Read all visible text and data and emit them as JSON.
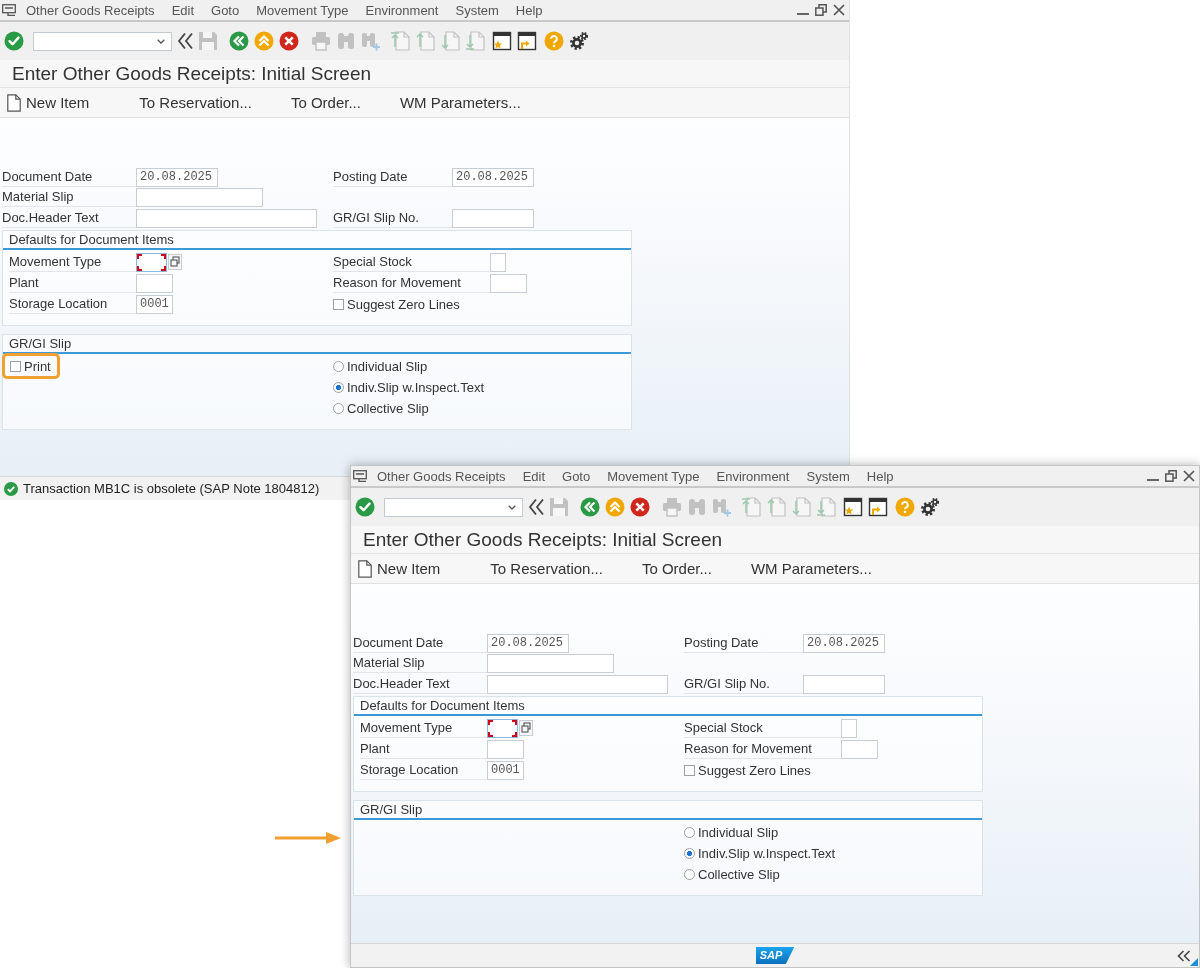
{
  "windows": [
    {
      "kind": "main",
      "menu": [
        "Other Goods Receipts",
        "Edit",
        "Goto",
        "Movement Type",
        "Environment",
        "System",
        "Help"
      ],
      "toolbar": [
        {
          "kind": "enter",
          "disabled": false
        },
        {
          "kind": "command-field",
          "disabled": false
        },
        {
          "kind": "hide-command",
          "disabled": false
        },
        {
          "kind": "save",
          "disabled": true
        },
        {
          "kind": "back",
          "disabled": false
        },
        {
          "kind": "exit",
          "disabled": false
        },
        {
          "kind": "cancel",
          "disabled": false
        },
        {
          "kind": "print",
          "disabled": true
        },
        {
          "kind": "find",
          "disabled": true
        },
        {
          "kind": "find-next",
          "disabled": true
        },
        {
          "kind": "first-page",
          "disabled": true
        },
        {
          "kind": "previous-page",
          "disabled": true
        },
        {
          "kind": "next-page",
          "disabled": true
        },
        {
          "kind": "last-page",
          "disabled": true
        },
        {
          "kind": "new-session",
          "disabled": false
        },
        {
          "kind": "shortcut",
          "disabled": false
        },
        {
          "kind": "help",
          "disabled": false
        },
        {
          "kind": "customize",
          "disabled": false
        }
      ],
      "title": "Enter Other Goods Receipts: Initial Screen",
      "app_toolbar": [
        {
          "kind": "create",
          "label": "New Item"
        },
        {
          "kind": "text",
          "label": "To Reservation..."
        },
        {
          "kind": "text",
          "label": "To Order..."
        },
        {
          "kind": "text",
          "label": "WM Parameters..."
        }
      ],
      "header_rows": [
        [
          {
            "label": "Document Date",
            "value": "20.08.2025"
          },
          {
            "label": "Posting Date",
            "value": "20.08.2025"
          }
        ],
        [
          {
            "label": "Material Slip"
          }
        ],
        [
          {
            "label": "Doc.Header Text"
          },
          {
            "label": "GR/GI Slip No."
          }
        ]
      ],
      "sections": [
        {
          "title": "Defaults for Document Items",
          "left": [
            {
              "kind": "field",
              "label": "Movement Type",
              "focused": true
            },
            {
              "kind": "field",
              "label": "Plant",
              "focused": false
            },
            {
              "kind": "field",
              "label": "Storage Location",
              "value": "0001",
              "focused": false
            }
          ],
          "right": [
            {
              "kind": "field",
              "label": "Special Stock",
              "focused": false
            },
            {
              "kind": "field",
              "label": "Reason for Movement",
              "focused": false
            },
            {
              "kind": "checkbox",
              "label": "Suggest Zero Lines",
              "checked": false,
              "highlighted": false
            }
          ]
        },
        {
          "title": "GR/GI Slip",
          "left": [
            {
              "kind": "checkbox",
              "label": "Print",
              "checked": false,
              "highlighted": true
            }
          ],
          "right": [
            {
              "kind": "radio",
              "label": "Individual Slip",
              "selected": false
            },
            {
              "kind": "radio",
              "label": "Indiv.Slip w.Inspect.Text",
              "selected": true
            },
            {
              "kind": "radio",
              "label": "Collective Slip",
              "selected": false
            }
          ]
        }
      ],
      "status_bar": {
        "kind": "success",
        "message": "Transaction MB1C is obsolete (SAP Note 1804812)"
      }
    },
    {
      "kind": "popup",
      "menu": [
        "Other Goods Receipts",
        "Edit",
        "Goto",
        "Movement Type",
        "Environment",
        "System",
        "Help"
      ],
      "toolbar": [
        {
          "kind": "enter",
          "disabled": false
        },
        {
          "kind": "command-field",
          "disabled": false
        },
        {
          "kind": "hide-command",
          "disabled": false
        },
        {
          "kind": "save",
          "disabled": true
        },
        {
          "kind": "back",
          "disabled": false
        },
        {
          "kind": "exit",
          "disabled": false
        },
        {
          "kind": "cancel",
          "disabled": false
        },
        {
          "kind": "print",
          "disabled": true
        },
        {
          "kind": "find",
          "disabled": true
        },
        {
          "kind": "find-next",
          "disabled": true
        },
        {
          "kind": "first-page",
          "disabled": true
        },
        {
          "kind": "previous-page",
          "disabled": true
        },
        {
          "kind": "next-page",
          "disabled": true
        },
        {
          "kind": "last-page",
          "disabled": true
        },
        {
          "kind": "new-session",
          "disabled": false
        },
        {
          "kind": "shortcut",
          "disabled": false
        },
        {
          "kind": "help",
          "disabled": false
        },
        {
          "kind": "customize",
          "disabled": false
        }
      ],
      "title": "Enter Other Goods Receipts: Initial Screen",
      "app_toolbar": [
        {
          "kind": "create",
          "label": "New Item"
        },
        {
          "kind": "text",
          "label": "To Reservation..."
        },
        {
          "kind": "text",
          "label": "To Order..."
        },
        {
          "kind": "text",
          "label": "WM Parameters..."
        }
      ],
      "header_rows": [
        [
          {
            "label": "Document Date",
            "value": "20.08.2025"
          },
          {
            "label": "Posting Date",
            "value": "20.08.2025"
          }
        ],
        [
          {
            "label": "Material Slip"
          }
        ],
        [
          {
            "label": "Doc.Header Text"
          },
          {
            "label": "GR/GI Slip No."
          }
        ]
      ],
      "sections": [
        {
          "title": "Defaults for Document Items",
          "left": [
            {
              "kind": "field",
              "label": "Movement Type",
              "focused": true
            },
            {
              "kind": "field",
              "label": "Plant",
              "focused": false
            },
            {
              "kind": "field",
              "label": "Storage Location",
              "value": "0001",
              "focused": false
            }
          ],
          "right": [
            {
              "kind": "field",
              "label": "Special Stock",
              "focused": false
            },
            {
              "kind": "field",
              "label": "Reason for Movement",
              "focused": false
            },
            {
              "kind": "checkbox",
              "label": "Suggest Zero Lines",
              "checked": false,
              "highlighted": false
            }
          ]
        },
        {
          "title": "GR/GI Slip",
          "right": [
            {
              "kind": "radio",
              "label": "Individual Slip",
              "selected": false
            },
            {
              "kind": "radio",
              "label": "Indiv.Slip w.Inspect.Text",
              "selected": true
            },
            {
              "kind": "radio",
              "label": "Collective Slip",
              "selected": false
            }
          ]
        }
      ],
      "status_bar": {
        "logo": "SAP"
      }
    }
  ],
  "annotations": [
    {
      "kind": "arrow"
    }
  ]
}
